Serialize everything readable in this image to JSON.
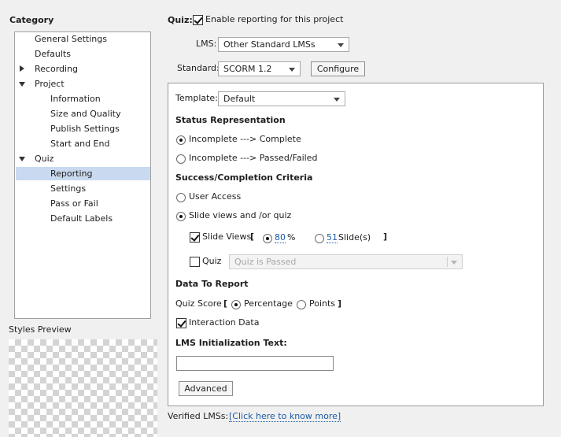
{
  "left": {
    "category_title": "Category",
    "tree": [
      {
        "label": "General Settings"
      },
      {
        "label": "Defaults"
      },
      {
        "label": "Recording"
      },
      {
        "label": "Project"
      },
      {
        "label": "Information"
      },
      {
        "label": "Size and Quality"
      },
      {
        "label": "Publish Settings"
      },
      {
        "label": "Start and End"
      },
      {
        "label": "Quiz"
      },
      {
        "label": "Reporting"
      },
      {
        "label": "Settings"
      },
      {
        "label": "Pass or Fail"
      },
      {
        "label": "Default Labels"
      }
    ],
    "styles_preview_label": "Styles Preview"
  },
  "quiz": {
    "title": "Quiz:",
    "enable_label": "Enable reporting for this project",
    "enable_checked": true
  },
  "lms": {
    "label": "LMS:",
    "value": "Other Standard LMSs"
  },
  "standard": {
    "label": "Standard:",
    "value": "SCORM 1.2",
    "configure_label": "Configure"
  },
  "template": {
    "label": "Template:",
    "value": "Default"
  },
  "status": {
    "heading": "Status Representation",
    "option1": "Incomplete ---> Complete",
    "option2": "Incomplete ---> Passed/Failed",
    "selected": 1
  },
  "criteria": {
    "heading": "Success/Completion Criteria",
    "user_access": "User Access",
    "slide_views_quiz": "Slide views and /or quiz",
    "selected": 2,
    "slide_views_label": "Slide Views",
    "slide_views_checked": true,
    "bracket_open": "[",
    "bracket_close": "]",
    "percent_value": "80",
    "percent_unit": "%",
    "slides_value": "51",
    "slides_unit": "Slide(s)",
    "quiz_label": "Quiz",
    "quiz_checked": false,
    "quiz_dropdown": "Quiz is Passed"
  },
  "report": {
    "heading": "Data To Report",
    "quiz_score_label": "Quiz Score",
    "bracket_open": "[",
    "bracket_close": "]",
    "percentage": "Percentage",
    "points": "Points",
    "interaction_label": "Interaction Data",
    "interaction_checked": true
  },
  "init": {
    "heading": "LMS Initialization Text:",
    "value": "",
    "advanced_label": "Advanced"
  },
  "footer": {
    "verified_label": "Verified LMSs:",
    "link_text": "[Click here to know more]"
  }
}
